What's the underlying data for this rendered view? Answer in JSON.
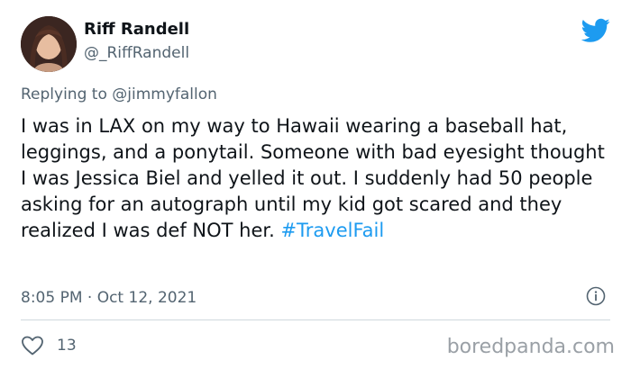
{
  "tweet": {
    "author_name": "Riff Randell",
    "author_handle": "@_RiffRandell",
    "replying_prefix": "Replying to",
    "replying_to": "@jimmyfallon",
    "body_text": "I was in LAX on my way to Hawaii wearing a baseball hat, leggings, and a ponytail. Someone with bad eyesight thought I was Jessica Biel and yelled it out. I suddenly had 50 people asking for an autograph until my kid got scared and they realized I was def NOT her. ",
    "hashtag": "#TravelFail",
    "timestamp": "8:05 PM · Oct 12, 2021",
    "like_count": "13"
  },
  "watermark": "boredpanda.com",
  "icons": {
    "platform": "twitter-bird-icon",
    "info": "info-icon",
    "like": "heart-icon"
  },
  "colors": {
    "twitter_blue": "#1d9bf0",
    "text_primary": "#0f1419",
    "text_secondary": "#536471",
    "divider": "#cfd9de"
  }
}
